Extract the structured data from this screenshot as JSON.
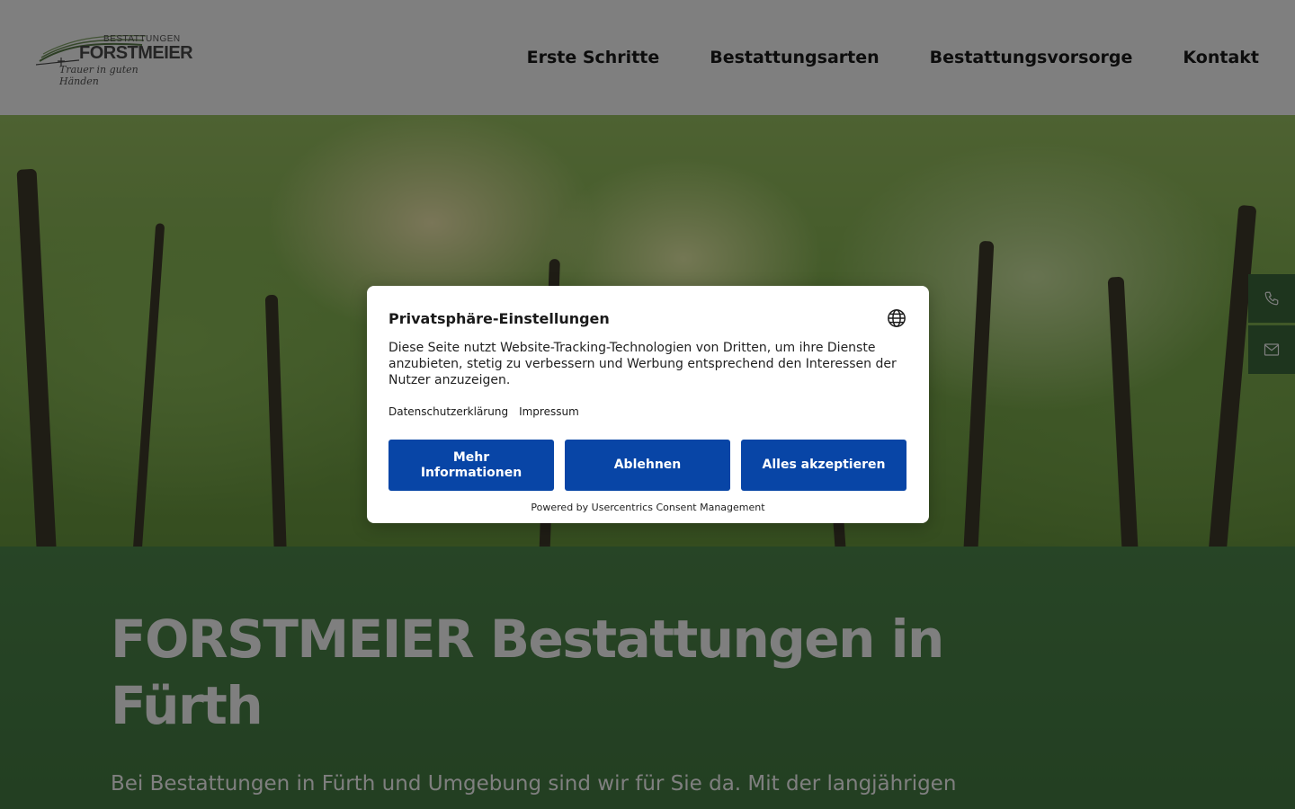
{
  "logo": {
    "top_text": "BESTATTUNGEN",
    "name": "FORSTMEIER",
    "tagline": "Trauer in guten Händen"
  },
  "nav": {
    "items": [
      {
        "label": "Erste Schritte"
      },
      {
        "label": "Bestattungsarten"
      },
      {
        "label": "Bestattungsvorsorge"
      },
      {
        "label": "Kontakt"
      }
    ]
  },
  "hero": {
    "headline": "FORSTMEIER Bestattungen in Fürth",
    "intro": "Bei Bestattungen in Fürth und Umgebung sind wir für Sie da. Mit der langjährigen"
  },
  "side_contact": {
    "phone_icon": "phone-icon",
    "mail_icon": "mail-icon"
  },
  "consent": {
    "title": "Privatsphäre-Einstellungen",
    "text": "Diese Seite nutzt Website-Tracking-Technologien von Dritten, um ihre Dienste anzubieten, stetig zu verbessern und Werbung entsprechend den Interessen der Nutzer anzuzeigen.",
    "links": {
      "privacy": "Datenschutzerklärung",
      "imprint": "Impressum"
    },
    "buttons": {
      "more": "Mehr Informationen",
      "deny": "Ablehnen",
      "accept": "Alles akzeptieren"
    },
    "powered_by": "Powered by Usercentrics Consent Management",
    "language_icon": "globe-icon"
  },
  "colors": {
    "consent_button": "#0845a6",
    "side_button": "#3c6b3d",
    "content_band": "#4f8a4c"
  }
}
